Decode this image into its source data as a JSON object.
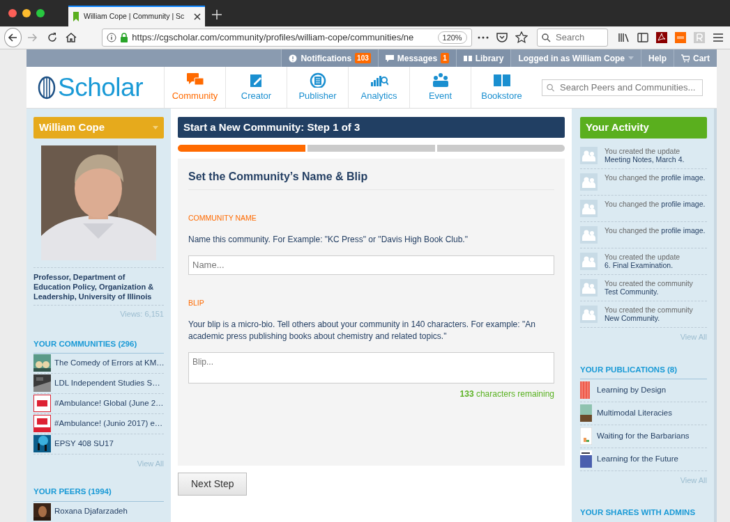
{
  "browser": {
    "tab_title": "William Cope | Community | Sc",
    "url": "https://cgscholar.com/community/profiles/william-cope/communities/ne",
    "zoom": "120%",
    "search_placeholder": "Search"
  },
  "top_bar": [
    {
      "kind": "badge",
      "label": "Notifications",
      "badge": "103"
    },
    {
      "kind": "badge",
      "label": "Messages",
      "badge": "1"
    },
    {
      "kind": "plain",
      "label": "Library"
    },
    {
      "kind": "dropdown",
      "label": "Logged in as William Cope"
    },
    {
      "kind": "plain",
      "label": "Help"
    },
    {
      "kind": "plain",
      "label": "Cart"
    }
  ],
  "logo": "Scholar",
  "nav": [
    {
      "label": "Community",
      "selected": true
    },
    {
      "label": "Creator",
      "selected": false
    },
    {
      "label": "Publisher",
      "selected": false
    },
    {
      "label": "Analytics",
      "selected": false
    },
    {
      "label": "Event",
      "selected": false
    },
    {
      "label": "Bookstore",
      "selected": false
    }
  ],
  "site_search": {
    "placeholder": "Search Peers and Communities..."
  },
  "profile": {
    "name": "William Cope",
    "bio": "Professor, Department of Education Policy, Organization & Leadership, University of Illinois",
    "views": "Views: 6,151"
  },
  "communities": {
    "title": "YOUR COMMUNITIES (296)",
    "items": [
      {
        "label": "The Comedy of Errors at KM…"
      },
      {
        "label": "LDL Independent Studies S…"
      },
      {
        "label": "#Ambulance! Global (June 2…"
      },
      {
        "label": "#Ambulance! (Junio 2017) e…"
      },
      {
        "label": "EPSY 408 SU17"
      }
    ],
    "view_all": "View All"
  },
  "peers": {
    "title": "YOUR PEERS (1994)",
    "items": [
      {
        "label": "Roxana Djafarzadeh"
      }
    ]
  },
  "wizard": {
    "title": "Start a New Community: Step 1 of 3",
    "steps": [
      {
        "done": true
      },
      {
        "done": false
      },
      {
        "done": false
      }
    ],
    "heading": "Set the Community’s Name & Blip",
    "name_label": "COMMUNITY NAME",
    "name_help": "Name this community. For Example: \"KC Press\" or \"Davis High Book Club.\"",
    "name_placeholder": "Name...",
    "blip_label": "BLIP",
    "blip_help": "Your blip is a micro-bio. Tell others about your community in 140 characters. For example: \"An academic press publishing books about chemistry and related topics.\"",
    "blip_placeholder": "Blip...",
    "counter": "**133** characters remaining",
    "next": "Next Step"
  },
  "activity": {
    "title": "Your Activity",
    "items": [
      {
        "text": "You created the update",
        "link": "Meeting Notes, March 4."
      },
      {
        "text": "You changed the",
        "link": "profile image."
      },
      {
        "text": "You changed the",
        "link": "profile image."
      },
      {
        "text": "You changed the",
        "link": "profile image."
      },
      {
        "text": "You created the update",
        "link": "6. Final Examination."
      },
      {
        "text": "You created the community",
        "link": "Test Community."
      },
      {
        "text": "You created the community",
        "link": "New Community."
      }
    ],
    "view_all": "View All"
  },
  "publications": {
    "title": "YOUR PUBLICATIONS (8)",
    "items": [
      {
        "label": "Learning by Design"
      },
      {
        "label": "Multimodal Literacies"
      },
      {
        "label": "Waiting for the Barbarians"
      },
      {
        "label": "Learning for the Future"
      }
    ],
    "view_all": "View All"
  },
  "shares": {
    "title": "YOUR SHARES WITH ADMINS"
  }
}
